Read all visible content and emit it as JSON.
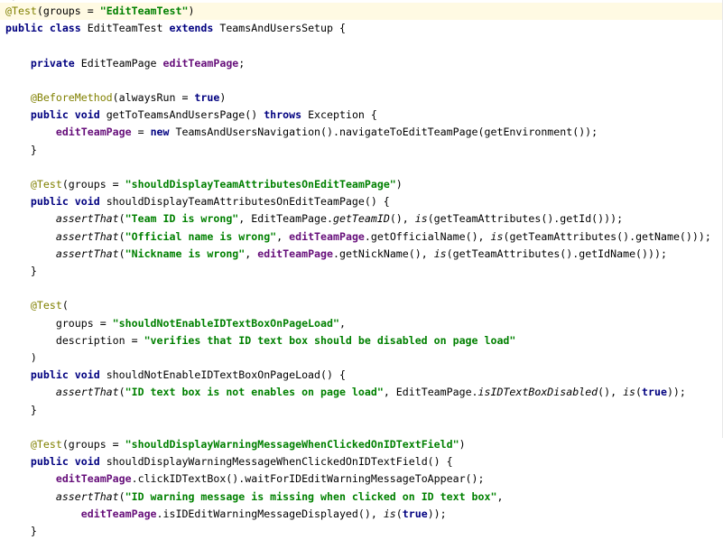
{
  "editor": {
    "lines": [
      {
        "highlight": true,
        "tokens": [
          {
            "t": "@Test",
            "c": "ann"
          },
          {
            "t": "(groups = ",
            "c": "text"
          },
          {
            "t": "\"EditTeamTest\"",
            "c": "str"
          },
          {
            "t": ")",
            "c": "text"
          }
        ]
      },
      {
        "tokens": [
          {
            "t": "public class ",
            "c": "kw"
          },
          {
            "t": "EditTeamTest ",
            "c": "text"
          },
          {
            "t": "extends ",
            "c": "kw"
          },
          {
            "t": "TeamsAndUsersSetup {",
            "c": "text"
          }
        ]
      },
      {
        "tokens": []
      },
      {
        "tokens": [
          {
            "t": "    ",
            "c": "text"
          },
          {
            "t": "private ",
            "c": "kw"
          },
          {
            "t": "EditTeamPage ",
            "c": "text"
          },
          {
            "t": "editTeamPage",
            "c": "field"
          },
          {
            "t": ";",
            "c": "text"
          }
        ]
      },
      {
        "tokens": []
      },
      {
        "tokens": [
          {
            "t": "    ",
            "c": "text"
          },
          {
            "t": "@BeforeMethod",
            "c": "ann"
          },
          {
            "t": "(alwaysRun = ",
            "c": "text"
          },
          {
            "t": "true",
            "c": "kw"
          },
          {
            "t": ")",
            "c": "text"
          }
        ]
      },
      {
        "tokens": [
          {
            "t": "    ",
            "c": "text"
          },
          {
            "t": "public void ",
            "c": "kw"
          },
          {
            "t": "getToTeamsAndUsersPage() ",
            "c": "text"
          },
          {
            "t": "throws ",
            "c": "kw"
          },
          {
            "t": "Exception {",
            "c": "text"
          }
        ]
      },
      {
        "tokens": [
          {
            "t": "        ",
            "c": "text"
          },
          {
            "t": "editTeamPage",
            "c": "field"
          },
          {
            "t": " = ",
            "c": "text"
          },
          {
            "t": "new ",
            "c": "kw"
          },
          {
            "t": "TeamsAndUsersNavigation().navigateToEditTeamPage(getEnvironment());",
            "c": "text"
          }
        ]
      },
      {
        "tokens": [
          {
            "t": "    }",
            "c": "text"
          }
        ]
      },
      {
        "tokens": []
      },
      {
        "tokens": [
          {
            "t": "    ",
            "c": "text"
          },
          {
            "t": "@Test",
            "c": "ann"
          },
          {
            "t": "(groups = ",
            "c": "text"
          },
          {
            "t": "\"shouldDisplayTeamAttributesOnEditTeamPage\"",
            "c": "str"
          },
          {
            "t": ")",
            "c": "text"
          }
        ]
      },
      {
        "tokens": [
          {
            "t": "    ",
            "c": "text"
          },
          {
            "t": "public void ",
            "c": "kw"
          },
          {
            "t": "shouldDisplayTeamAttributesOnEditTeamPage() {",
            "c": "text"
          }
        ]
      },
      {
        "tokens": [
          {
            "t": "        ",
            "c": "text"
          },
          {
            "t": "assertThat",
            "c": "static"
          },
          {
            "t": "(",
            "c": "text"
          },
          {
            "t": "\"Team ID is wrong\"",
            "c": "str"
          },
          {
            "t": ", EditTeamPage.",
            "c": "text"
          },
          {
            "t": "getTeamID",
            "c": "static"
          },
          {
            "t": "(), ",
            "c": "text"
          },
          {
            "t": "is",
            "c": "static"
          },
          {
            "t": "(getTeamAttributes().getId()));",
            "c": "text"
          }
        ]
      },
      {
        "tokens": [
          {
            "t": "        ",
            "c": "text"
          },
          {
            "t": "assertThat",
            "c": "static"
          },
          {
            "t": "(",
            "c": "text"
          },
          {
            "t": "\"Official name is wrong\"",
            "c": "str"
          },
          {
            "t": ", ",
            "c": "text"
          },
          {
            "t": "editTeamPage",
            "c": "field"
          },
          {
            "t": ".getOfficialName(), ",
            "c": "text"
          },
          {
            "t": "is",
            "c": "static"
          },
          {
            "t": "(getTeamAttributes().getName()));",
            "c": "text"
          }
        ]
      },
      {
        "tokens": [
          {
            "t": "        ",
            "c": "text"
          },
          {
            "t": "assertThat",
            "c": "static"
          },
          {
            "t": "(",
            "c": "text"
          },
          {
            "t": "\"Nickname is wrong\"",
            "c": "str"
          },
          {
            "t": ", ",
            "c": "text"
          },
          {
            "t": "editTeamPage",
            "c": "field"
          },
          {
            "t": ".getNickName(), ",
            "c": "text"
          },
          {
            "t": "is",
            "c": "static"
          },
          {
            "t": "(getTeamAttributes().getIdName()));",
            "c": "text"
          }
        ]
      },
      {
        "tokens": [
          {
            "t": "    }",
            "c": "text"
          }
        ]
      },
      {
        "tokens": []
      },
      {
        "tokens": [
          {
            "t": "    ",
            "c": "text"
          },
          {
            "t": "@Test",
            "c": "ann"
          },
          {
            "t": "(",
            "c": "text"
          }
        ]
      },
      {
        "tokens": [
          {
            "t": "        groups = ",
            "c": "text"
          },
          {
            "t": "\"shouldNotEnableIDTextBoxOnPageLoad\"",
            "c": "str"
          },
          {
            "t": ",",
            "c": "text"
          }
        ]
      },
      {
        "tokens": [
          {
            "t": "        description = ",
            "c": "text"
          },
          {
            "t": "\"verifies that ID text box should be disabled on page load\"",
            "c": "str"
          }
        ]
      },
      {
        "tokens": [
          {
            "t": "    )",
            "c": "text"
          }
        ]
      },
      {
        "tokens": [
          {
            "t": "    ",
            "c": "text"
          },
          {
            "t": "public void ",
            "c": "kw"
          },
          {
            "t": "shouldNotEnableIDTextBoxOnPageLoad() {",
            "c": "text"
          }
        ]
      },
      {
        "tokens": [
          {
            "t": "        ",
            "c": "text"
          },
          {
            "t": "assertThat",
            "c": "static"
          },
          {
            "t": "(",
            "c": "text"
          },
          {
            "t": "\"ID text box is not enables on page load\"",
            "c": "str"
          },
          {
            "t": ", EditTeamPage.",
            "c": "text"
          },
          {
            "t": "isIDTextBoxDisabled",
            "c": "static"
          },
          {
            "t": "(), ",
            "c": "text"
          },
          {
            "t": "is",
            "c": "static"
          },
          {
            "t": "(",
            "c": "text"
          },
          {
            "t": "true",
            "c": "kw"
          },
          {
            "t": "));",
            "c": "text"
          }
        ]
      },
      {
        "tokens": [
          {
            "t": "    }",
            "c": "text"
          }
        ]
      },
      {
        "tokens": []
      },
      {
        "tokens": [
          {
            "t": "    ",
            "c": "text"
          },
          {
            "t": "@Test",
            "c": "ann"
          },
          {
            "t": "(groups = ",
            "c": "text"
          },
          {
            "t": "\"shouldDisplayWarningMessageWhenClickedOnIDTextField\"",
            "c": "str"
          },
          {
            "t": ")",
            "c": "text"
          }
        ]
      },
      {
        "tokens": [
          {
            "t": "    ",
            "c": "text"
          },
          {
            "t": "public void ",
            "c": "kw"
          },
          {
            "t": "shouldDisplayWarningMessageWhenClickedOnIDTextField() {",
            "c": "text"
          }
        ]
      },
      {
        "tokens": [
          {
            "t": "        ",
            "c": "text"
          },
          {
            "t": "editTeamPage",
            "c": "field"
          },
          {
            "t": ".clickIDTextBox().waitForIDEditWarningMessageToAppear();",
            "c": "text"
          }
        ]
      },
      {
        "tokens": [
          {
            "t": "        ",
            "c": "text"
          },
          {
            "t": "assertThat",
            "c": "static"
          },
          {
            "t": "(",
            "c": "text"
          },
          {
            "t": "\"ID warning message is missing when clicked on ID text box\"",
            "c": "str"
          },
          {
            "t": ",",
            "c": "text"
          }
        ]
      },
      {
        "tokens": [
          {
            "t": "            ",
            "c": "text"
          },
          {
            "t": "editTeamPage",
            "c": "field"
          },
          {
            "t": ".isIDEditWarningMessageDisplayed(), ",
            "c": "text"
          },
          {
            "t": "is",
            "c": "static"
          },
          {
            "t": "(",
            "c": "text"
          },
          {
            "t": "true",
            "c": "kw"
          },
          {
            "t": "));",
            "c": "text"
          }
        ]
      },
      {
        "tokens": [
          {
            "t": "    }",
            "c": "text"
          }
        ]
      }
    ]
  }
}
